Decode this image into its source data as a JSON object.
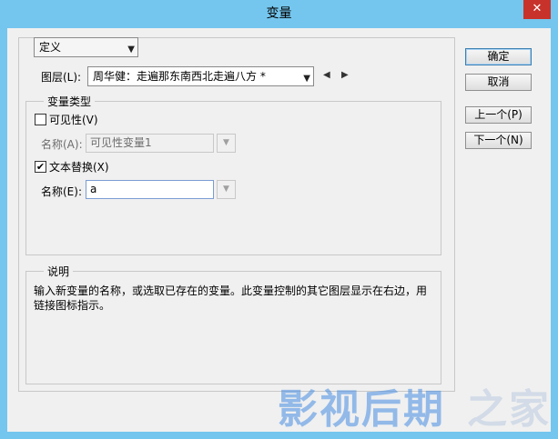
{
  "window": {
    "title": "变量",
    "close_glyph": "✕"
  },
  "definition": {
    "mode_value": "定义"
  },
  "layer": {
    "label": "图层(L):",
    "value": "周华健：走遍那东南西北走遍八方 *"
  },
  "variable_type": {
    "legend": "变量类型",
    "visibility": {
      "checkbox_label": "可见性(V)",
      "checked": false,
      "name_label": "名称(A):",
      "name_value": "可见性变量1"
    },
    "text_replace": {
      "checkbox_label": "文本替换(X)",
      "checked": true,
      "name_label": "名称(E):",
      "name_value": "a"
    }
  },
  "description": {
    "legend": "说明",
    "line1": "输入新变量的名称，或选取已存在的变量。此变量控制的其它图层显示在右边，用",
    "line2": "链接图标指示。"
  },
  "buttons": {
    "ok": "确定",
    "cancel": "取消",
    "prev": "上一个(P)",
    "next": "下一个(N)"
  },
  "watermark": {
    "text1": "影视后期",
    "text2": "之家"
  }
}
